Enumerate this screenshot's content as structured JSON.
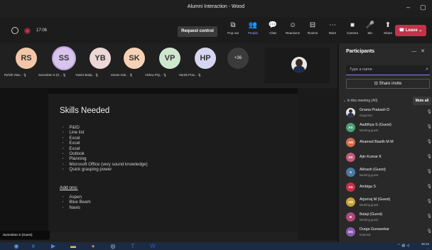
{
  "window": {
    "title": "Alumni Interaction - Wood",
    "controls": [
      "–",
      "▢"
    ]
  },
  "toolbar": {
    "timer": "17:06",
    "request_control": "Request control",
    "buttons": [
      {
        "label": "Pop out",
        "icon": "pop-out-icon",
        "glyph": "⧉"
      },
      {
        "label": "People",
        "icon": "people-icon",
        "glyph": "👥"
      },
      {
        "label": "Chat",
        "icon": "chat-icon",
        "glyph": "💬"
      },
      {
        "label": "Reactions",
        "icon": "reactions-icon",
        "glyph": "☺"
      },
      {
        "label": "Rooms",
        "icon": "rooms-icon",
        "glyph": "⊟"
      },
      {
        "label": "More",
        "icon": "more-icon",
        "glyph": "⋯"
      },
      {
        "label": "Camera",
        "icon": "camera-icon",
        "glyph": "■"
      },
      {
        "label": "Mic",
        "icon": "mic-icon",
        "glyph": "🎤"
      },
      {
        "label": "Share",
        "icon": "share-icon",
        "glyph": "⬆"
      }
    ],
    "leave": "Leave"
  },
  "stage": {
    "avatars": [
      {
        "initials": "RS",
        "name": "Rohith Visw...",
        "color": "#f4c6a8"
      },
      {
        "initials": "SS",
        "name": "Surendran S (G...",
        "color": "#d8c4ec"
      },
      {
        "initials": "YB",
        "name": "Yamini Balaj...",
        "color": "#ecd8d6"
      },
      {
        "initials": "SK",
        "name": "Sriram Gok...",
        "color": "#f6d2b4"
      },
      {
        "initials": "VP",
        "name": "Vishnu Priy...",
        "color": "#cfe6cf"
      },
      {
        "initials": "HP",
        "name": "Harish Prav...",
        "color": "#d6d6f2"
      }
    ],
    "more_count": "+36",
    "presenter_badge": "Surendran S (Guest)"
  },
  "slide": {
    "title": "Skills Needed",
    "items": [
      "P&ID",
      "Line list",
      "Excel",
      "Excel",
      "Excel",
      "Outlook",
      "Planning",
      "Microsoft Office (very sound knowledge)",
      "Quick grasping power"
    ],
    "addons_heading": "Add ons:",
    "addons": [
      "Aspen",
      "Blue Beam",
      "Navis"
    ]
  },
  "panel": {
    "title": "Participants",
    "search_placeholder": "Type a name",
    "share_invite": "Share invite",
    "in_meeting": "In this meeting (40)",
    "mute_all": "Mute all",
    "participants": [
      {
        "initials": "",
        "name": "Gnana Prakash D",
        "role": "Organizer",
        "color": "#e6e6e6",
        "photo": true
      },
      {
        "initials": "AS",
        "name": "Aadithya S (Guest)",
        "role": "Meeting guest",
        "color": "#4e9e78",
        "photo": false
      },
      {
        "initials": "AM",
        "name": "Ahamed Basith M M",
        "role": "",
        "color": "#d46a4a",
        "photo": false
      },
      {
        "initials": "AK",
        "name": "Ajin Kumar K",
        "role": "",
        "color": "#c45a7a",
        "photo": false
      },
      {
        "initials": "A",
        "name": "Akhash (Guest)",
        "role": "Meeting guest",
        "color": "#4a7aa6",
        "photo": false
      },
      {
        "initials": "AS",
        "name": "Ambiga S",
        "role": "",
        "color": "#c4314b",
        "photo": false
      },
      {
        "initials": "AM",
        "name": "Arjunraj M (Guest)",
        "role": "Meeting guest",
        "color": "#c8a23a",
        "photo": false
      },
      {
        "initials": "B",
        "name": "Balaji (Guest)",
        "role": "Meeting guest",
        "color": "#b04a7a",
        "photo": false
      },
      {
        "initials": "DG",
        "name": "Durga Gunasekar",
        "role": "External",
        "color": "#8a5ab0",
        "photo": false
      }
    ]
  },
  "taskbar": {
    "time": "18:12",
    "date": "...",
    "apps": [
      {
        "icon": "start-icon",
        "glyph": "◉",
        "color": "#5aa0e8"
      },
      {
        "icon": "edge-icon",
        "glyph": "e",
        "color": "#3a8ad8"
      },
      {
        "icon": "media-icon",
        "glyph": "▶",
        "color": "#4a8ae0"
      },
      {
        "icon": "folder-icon",
        "glyph": "▬",
        "color": "#e8c24a"
      },
      {
        "icon": "firefox-icon",
        "glyph": "●",
        "color": "#e87a2a"
      },
      {
        "icon": "chrome-icon",
        "glyph": "◎",
        "color": "#d8d8d8"
      },
      {
        "icon": "teams-icon",
        "glyph": "T",
        "color": "#6264a7"
      },
      {
        "icon": "word-icon",
        "glyph": "W",
        "color": "#2b5ca8"
      }
    ]
  }
}
